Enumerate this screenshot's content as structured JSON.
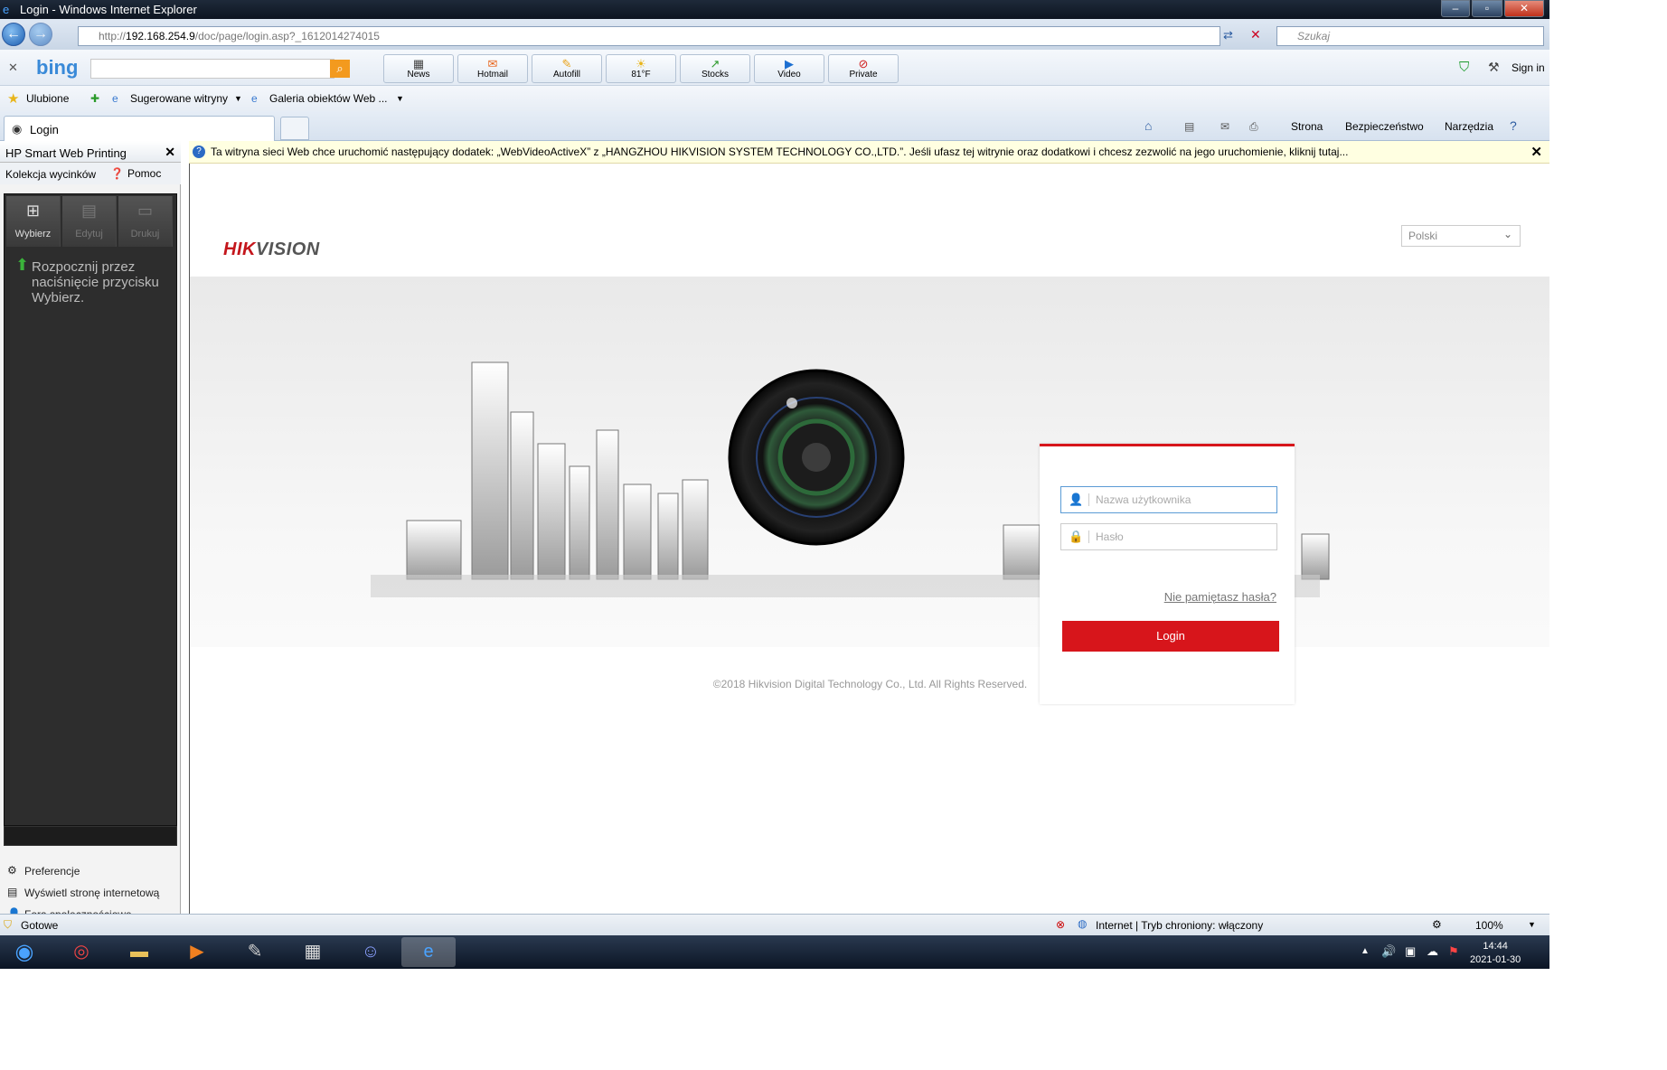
{
  "window": {
    "title": "Login - Windows Internet Explorer"
  },
  "address": {
    "prefix": "http://",
    "host": "192.168.254.9",
    "path": "/doc/page/login.asp?_1612014274015",
    "search_placeholder": "Szukaj"
  },
  "bing": {
    "logo": "bing",
    "buttons": [
      "News",
      "Hotmail",
      "Autofill",
      "81°F",
      "Stocks",
      "Video",
      "Private"
    ],
    "signin": "Sign in"
  },
  "favorites": {
    "label": "Ulubione",
    "items": [
      "Sugerowane witryny",
      "Galeria obiektów Web ..."
    ]
  },
  "tab": {
    "title": "Login"
  },
  "commands": [
    "Strona",
    "Bezpieczeństwo",
    "Narzędzia"
  ],
  "left_panel": {
    "title": "HP Smart Web Printing",
    "collection": "Kolekcja wycinków",
    "help": "Pomoc",
    "tools": [
      "Wybierz",
      "Edytuj",
      "Drukuj"
    ],
    "message": "Rozpocznij przez naciśnięcie przycisku Wybierz.",
    "links": [
      "Preferencje",
      "Wyświetl stronę internetową",
      "Fora społecznościowe"
    ]
  },
  "infobar": {
    "text": "Ta witryna sieci Web chce uruchomić następujący dodatek: „WebVideoActiveX” z „HANGZHOU HIKVISION SYSTEM TECHNOLOGY CO.,LTD.”. Jeśli ufasz tej witrynie oraz dodatkowi i chcesz zezwolić na jego uruchomienie, kliknij tutaj..."
  },
  "page": {
    "logo_red": "HIK",
    "logo_grey": "VISION",
    "language": "Polski",
    "username_placeholder": "Nazwa użytkownika",
    "password_placeholder": "Hasło",
    "forgot": "Nie pamiętasz hasła?",
    "login": "Login",
    "copyright": "©2018 Hikvision Digital Technology Co., Ltd. All Rights Reserved."
  },
  "status": {
    "left": "Gotowe",
    "zone": "Internet | Tryb chroniony: włączony",
    "zoom": "100%"
  },
  "taskbar": {
    "time": "14:44",
    "date": "2021-01-30"
  }
}
